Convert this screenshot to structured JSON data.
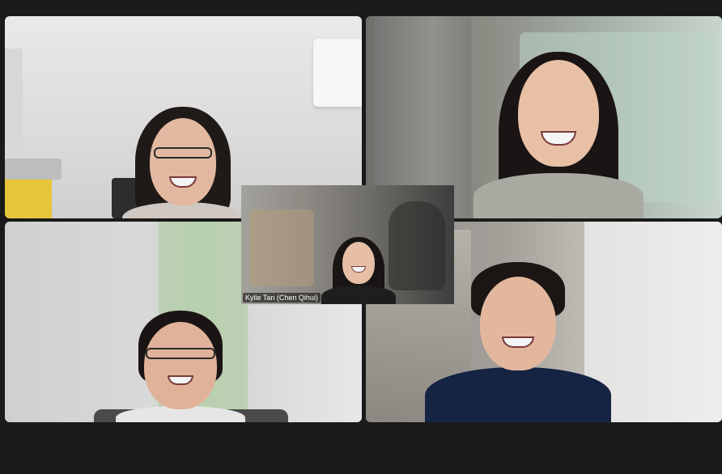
{
  "meeting": {
    "participants": [
      {
        "name": "",
        "tile": "top-left",
        "active_speaker": false
      },
      {
        "name": "",
        "tile": "top-right",
        "active_speaker": true
      },
      {
        "name": "",
        "tile": "bottom-left",
        "active_speaker": false
      },
      {
        "name": "",
        "tile": "bottom-right",
        "active_speaker": false
      },
      {
        "name": "Kylie Tan (Chen Qihui)",
        "tile": "center-floating",
        "active_speaker": false
      }
    ],
    "colors": {
      "background": "#1a1a1a",
      "active_speaker_border": "#5fd35f",
      "name_tag_bg": "rgba(0,0,0,0.55)"
    }
  }
}
